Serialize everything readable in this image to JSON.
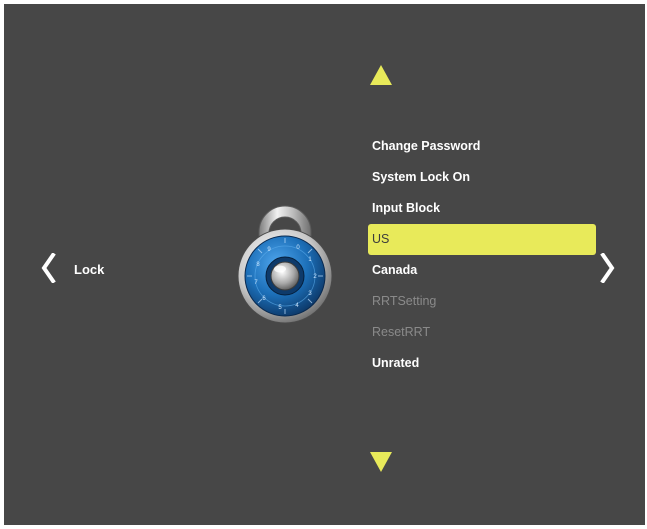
{
  "screen": {
    "section_title": "Lock",
    "nav_left_icon": "chevron-left-icon",
    "nav_right_icon": "chevron-right-icon",
    "scroll_up_icon": "triangle-up-icon",
    "scroll_down_icon": "triangle-down-icon",
    "illustration_icon": "combination-padlock-icon",
    "dial_numbers": [
      "0",
      "1",
      "2",
      "3",
      "4",
      "5",
      "6",
      "7",
      "8",
      "9"
    ]
  },
  "menu": {
    "items": [
      {
        "label": "Change Password",
        "state": "normal"
      },
      {
        "label": "System Lock On",
        "state": "normal"
      },
      {
        "label": "Input Block",
        "state": "normal"
      },
      {
        "label": "US",
        "state": "selected"
      },
      {
        "label": "Canada",
        "state": "normal"
      },
      {
        "label": "RRTSetting",
        "state": "disabled"
      },
      {
        "label": "ResetRRT",
        "state": "disabled"
      },
      {
        "label": "Unrated",
        "state": "normal"
      }
    ]
  },
  "colors": {
    "background": "#474747",
    "highlight": "#e8ea5a",
    "arrow": "#e8ea5a",
    "text": "#ffffff",
    "disabled_text": "#8a8a8a",
    "dial_blue": "#1c6fb8"
  }
}
